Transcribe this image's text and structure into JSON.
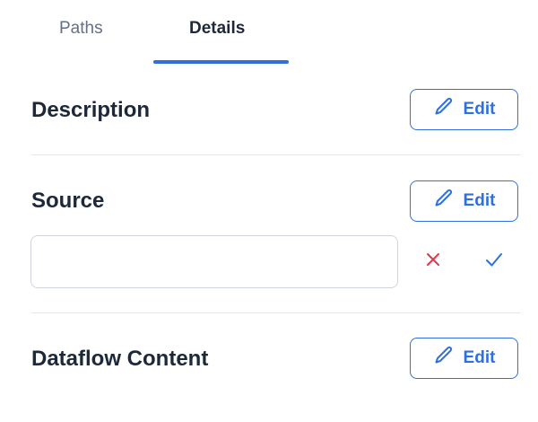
{
  "tabs": {
    "paths_label": "Paths",
    "details_label": "Details",
    "active": "Details"
  },
  "sections": {
    "description": {
      "title": "Description",
      "edit_label": "Edit"
    },
    "source": {
      "title": "Source",
      "edit_label": "Edit",
      "input_value": "",
      "input_placeholder": ""
    },
    "dataflow_content": {
      "title": "Dataflow Content",
      "edit_label": "Edit"
    }
  },
  "colors": {
    "accent": "#2f6fdf",
    "cancel": "#e0384f",
    "text": "#1d2939",
    "muted": "#667085",
    "divider": "#e4e7ec"
  },
  "icons": {
    "edit": "pencil-icon",
    "cancel": "close-icon",
    "confirm": "check-icon"
  }
}
